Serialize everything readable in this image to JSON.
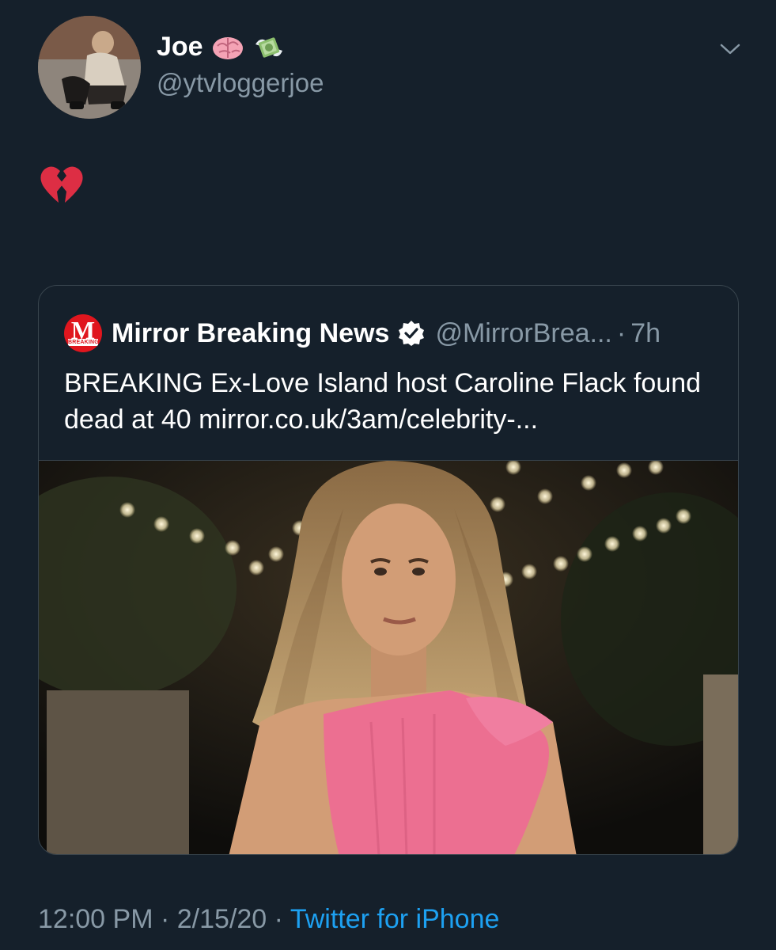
{
  "author": {
    "name": "Joe",
    "handle": "@ytvloggerjoe",
    "name_emojis": [
      "brain-emoji",
      "money-with-wings-emoji"
    ]
  },
  "tweet": {
    "body_emoji": "broken-heart-emoji"
  },
  "quoted_tweet": {
    "name": "Mirror Breaking News",
    "logo_letter": "M",
    "logo_banner": "BREAKING",
    "handle": "@MirrorBrea...",
    "dot": "·",
    "time": "7h",
    "text": "BREAKING Ex-Love Island host Caroline Flack found dead at 40  mirror.co.uk/3am/celebrity-..."
  },
  "footer": {
    "time": "12:00 PM",
    "sep1": "·",
    "date": "2/15/20",
    "sep2": "·",
    "source": "Twitter for iPhone"
  },
  "colors": {
    "background": "#15202b",
    "secondary_text": "#8899a6",
    "link": "#1da1f2",
    "border": "#38444d"
  }
}
